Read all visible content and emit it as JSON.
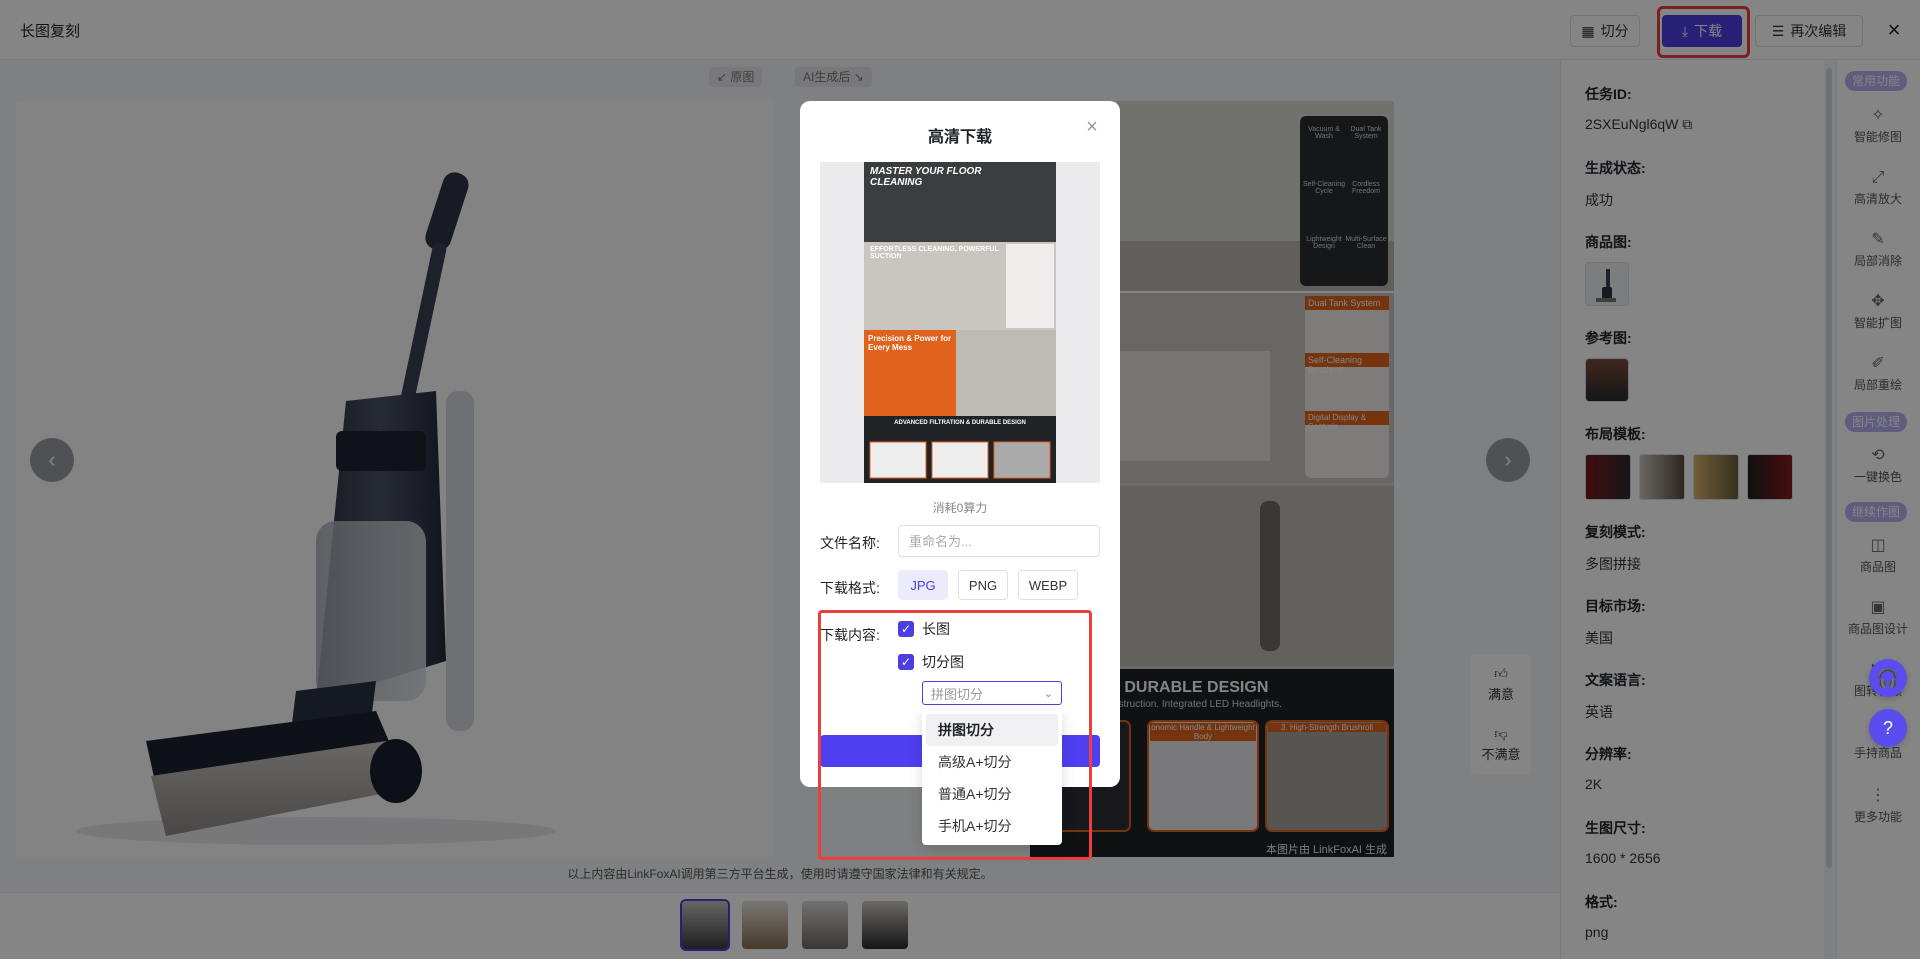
{
  "header": {
    "title": "长图复刻",
    "split_label": "切分",
    "download_label": "下载",
    "reedit_label": "再次编辑"
  },
  "stage": {
    "orig_tag": "↙ 原图",
    "ai_tag": "AI生成后 ↘",
    "disclaimer": "以上内容由LinkFoxAI调用第三方平台生成，使用时请遵守国家法律和有关规定。",
    "feedback": {
      "like": "满意",
      "dislike": "不满意"
    },
    "ai_texts": {
      "banner": "TRATION & DURABLE DESIGN",
      "banner_sub": "-Strength ABS Construction. Integrated LED Headlights.",
      "icon_labels": [
        "Vacuum & Wash",
        "Dual Tank System",
        "Self-Cleaning Cycle",
        "Cordless Freedom",
        "Lightweight Design",
        "Multi-Surface Clean"
      ],
      "tags": [
        "Dual Tank System",
        "Self-Cleaning Brushroll",
        "Digital Display & Controls"
      ],
      "bottom_tags": [
        "onomic Handle & Lightweight Body",
        "3. High-Strength Brushroll"
      ],
      "watermark": "本图片由 LinkFoxAI 生成"
    }
  },
  "info": {
    "task_id_label": "任务ID:",
    "task_id": "2SXEuNgl6qW",
    "status_label": "生成状态:",
    "status": "成功",
    "product_label": "商品图:",
    "reference_label": "参考图:",
    "layout_label": "布局模板:",
    "mode_label": "复刻模式:",
    "mode": "多图拼接",
    "market_label": "目标市场:",
    "market": "美国",
    "language_label": "文案语言:",
    "language": "英语",
    "resolution_label": "分辨率:",
    "resolution": "2K",
    "size_label": "生图尺寸:",
    "size": "1600 * 2656",
    "format_label": "格式:",
    "format": "png"
  },
  "tools": {
    "section_common": "常用功能",
    "section_image": "图片处理",
    "section_continue": "继续作图",
    "items": [
      {
        "label": "智能修图",
        "icon": "magic-wand-icon",
        "glyph": "✧"
      },
      {
        "label": "高清放大",
        "icon": "expand-icon",
        "glyph": "⤢"
      },
      {
        "label": "局部消除",
        "icon": "eraser-icon",
        "glyph": "✎"
      },
      {
        "label": "智能扩图",
        "icon": "expand-arrows-icon",
        "glyph": "✥"
      },
      {
        "label": "局部重绘",
        "icon": "brush-icon",
        "glyph": "✐"
      },
      {
        "label": "一键换色",
        "icon": "color-swap-icon",
        "glyph": "⟲"
      },
      {
        "label": "商品图",
        "icon": "bag-icon",
        "glyph": "◫"
      },
      {
        "label": "商品图设计",
        "icon": "layout-icon",
        "glyph": "▣"
      },
      {
        "label": "图转视频",
        "icon": "video-icon",
        "glyph": "▶"
      },
      {
        "label": "手持商品",
        "icon": "hand-icon",
        "glyph": "☝"
      },
      {
        "label": "更多功能",
        "icon": "more-icon",
        "glyph": "⋮"
      }
    ],
    "fab_support": "🎧",
    "fab_help": "?"
  },
  "modal": {
    "title": "高清下载",
    "cost": "消耗0算力",
    "filename_label": "文件名称:",
    "filename_value": "",
    "filename_placeholder": "重命名为...",
    "format_label": "下载格式:",
    "formats": [
      "JPG",
      "PNG",
      "WEBP"
    ],
    "format_selected": "JPG",
    "content_label": "下载内容:",
    "content_long": "长图",
    "content_split": "切分图",
    "split_select_value": "拼图切分",
    "download_button": "下载",
    "dropdown_options": [
      "拼图切分",
      "高级A+切分",
      "普通A+切分",
      "手机A+切分"
    ],
    "preview": {
      "headline": "MASTER YOUR FLOOR CLEANING",
      "sec2": "EFFORTLESS CLEANING, POWERFUL SUCTION",
      "sec3": "Precision & Power for Every Mess",
      "sec4": "ADVANCED FILTRATION & DURABLE DESIGN"
    }
  },
  "colors": {
    "accent": "#4b3fe3",
    "highlight": "#ee3d3d",
    "orange": "#e0621c"
  }
}
